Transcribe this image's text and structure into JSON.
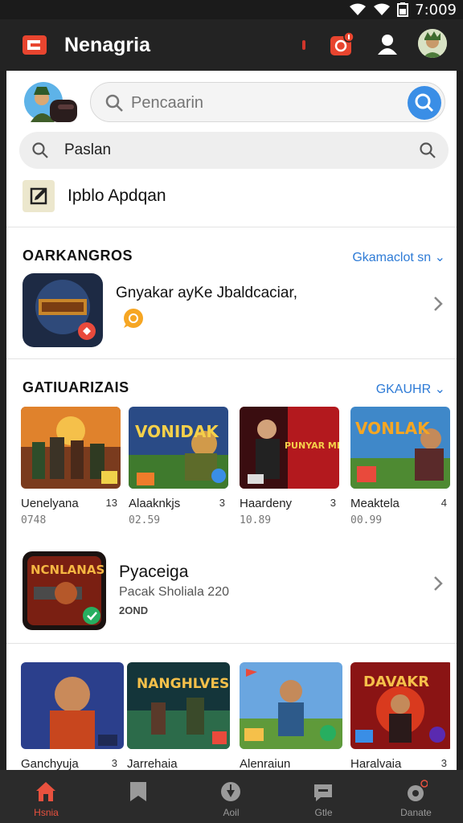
{
  "status_bar": {
    "time": "7:009"
  },
  "app_bar": {
    "title": "Nenagria"
  },
  "search": {
    "placeholder": "Pencaarin"
  },
  "search_secondary": {
    "label": "Paslan"
  },
  "edit_row": {
    "label": "Ipblo Apdqan"
  },
  "section_featured": {
    "title": "OARKANGROS",
    "link": "Gkamaclot sn",
    "item_title": "Gnyakar ayKe Jbaldcaciar,"
  },
  "section_games": {
    "title": "GATIUARIZAIS",
    "link": "GKAUHR",
    "cards": [
      {
        "name": "Uenelyana",
        "tag": "13",
        "time": "0748",
        "thumb_text": ""
      },
      {
        "name": "Alaaknkjs",
        "tag": "3",
        "time": "02.59",
        "thumb_text": "VONIDAK"
      },
      {
        "name": "Haardeny",
        "tag": "3",
        "time": "10.89",
        "thumb_text": "PUNYAR MENGOUF"
      },
      {
        "name": "Meaktela",
        "tag": "4",
        "time": "00.99",
        "thumb_text": "VONLAK"
      }
    ]
  },
  "promo": {
    "title": "Pyaceiga",
    "subtitle": "Pacak Sholiala 220",
    "meta": "2OND",
    "thumb_text": "NCNLANAS"
  },
  "games_row2": {
    "cards": [
      {
        "name": "Ganchyuja",
        "tag": "3",
        "thumb_text": ""
      },
      {
        "name": "Jarrehaia",
        "tag": "",
        "thumb_text": "NANGHLVES"
      },
      {
        "name": "Alenraiun",
        "tag": "",
        "thumb_text": ""
      },
      {
        "name": "Haralvaia",
        "tag": "3",
        "thumb_text": "DAVAKR"
      }
    ]
  },
  "bottom_nav": {
    "items": [
      {
        "label": "Hsnia",
        "icon": "home-icon",
        "active": true
      },
      {
        "label": "",
        "icon": "bookmark-icon",
        "active": false
      },
      {
        "label": "Aoil",
        "icon": "compass-icon",
        "active": false
      },
      {
        "label": "Gtle",
        "icon": "chat-icon",
        "active": false
      },
      {
        "label": "Danate",
        "icon": "settings-icon",
        "active": false
      }
    ]
  },
  "colors": {
    "accent": "#e8513e",
    "link": "#2e7bd6",
    "search_button": "#3a8ee6",
    "app_bar": "#232323"
  }
}
